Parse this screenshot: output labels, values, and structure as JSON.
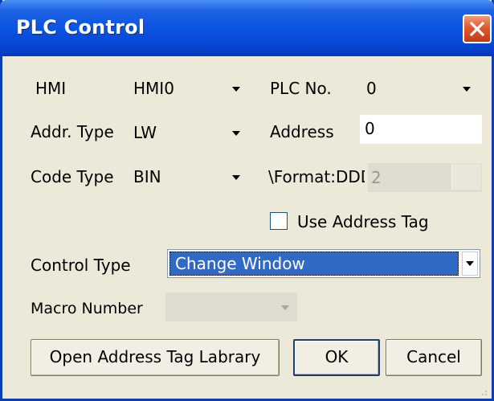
{
  "window": {
    "title": "PLC Control",
    "close_icon": "close-icon"
  },
  "form": {
    "hmi_label": "HMI",
    "hmi_value": "HMI0",
    "plc_no_label": "PLC No.",
    "plc_no_value": "0",
    "addr_type_label": "Addr. Type",
    "addr_type_value": "LW",
    "address_label": "Address",
    "address_value": "0",
    "code_type_label": "Code Type",
    "code_type_value": "BIN",
    "format_label": "\\Format:DDD",
    "format_value": "2",
    "use_address_tag_label": "Use Address Tag",
    "use_address_tag_checked": false,
    "control_type_label": "Control Type",
    "control_type_value": "Change Window",
    "macro_number_label": "Macro Number",
    "macro_number_value": ""
  },
  "buttons": {
    "open_tag_library": "Open Address Tag Labrary",
    "ok": "OK",
    "cancel": "Cancel"
  },
  "colors": {
    "title_bar": "#0a54e2",
    "close_button": "#e0592c",
    "selection": "#316ac5",
    "dialog_bg": "#ece9d8"
  }
}
